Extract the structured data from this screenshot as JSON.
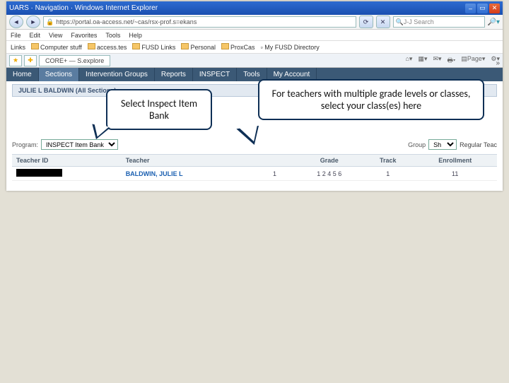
{
  "window": {
    "title": "UARS · Navigation · Windows Internet Explorer",
    "url": "https://portal.oa-access.net/~cas/rsx-prof.s=ekans",
    "search_placeholder": "J-J Search"
  },
  "menus": [
    "File",
    "Edit",
    "View",
    "Favorites",
    "Tools",
    "Help"
  ],
  "links_label": "Links",
  "link_items": [
    "Computer stuff",
    "access.tes",
    "FUSD Links",
    "Personal",
    "ProxCas",
    "My FUSD Directory"
  ],
  "page_tab": "CORE+ — S.explore",
  "toolicons": [
    "home-icon",
    "feed-icon",
    "mail-icon",
    "print-icon",
    "page-icon",
    "tools-icon"
  ],
  "app_tabs": [
    "Home",
    "Sections",
    "Intervention Groups",
    "Reports",
    "INSPECT",
    "Tools",
    "My Account"
  ],
  "active_app_tab": 1,
  "crumb": "JULIE L BALDWIN (All Sections)",
  "filters": {
    "program_label": "Program:",
    "program_value": "INSPECT Item Bank",
    "group_label": "Group",
    "group_value": "Sh",
    "teacher_label": "Regular Teac"
  },
  "grid": {
    "headers": [
      "Teacher ID",
      "Teacher",
      "",
      "Grade",
      "Track",
      "Enrollment"
    ],
    "row": {
      "teacher_id": "",
      "teacher": "BALDWIN, JULIE L",
      "section": "1",
      "grade": "1 2 4 5 6",
      "track": "1",
      "enrollment": "11"
    }
  },
  "callouts": {
    "small": "Select Inspect Item Bank",
    "big": "For teachers with multiple grade levels or classes, select your class(es) here"
  }
}
